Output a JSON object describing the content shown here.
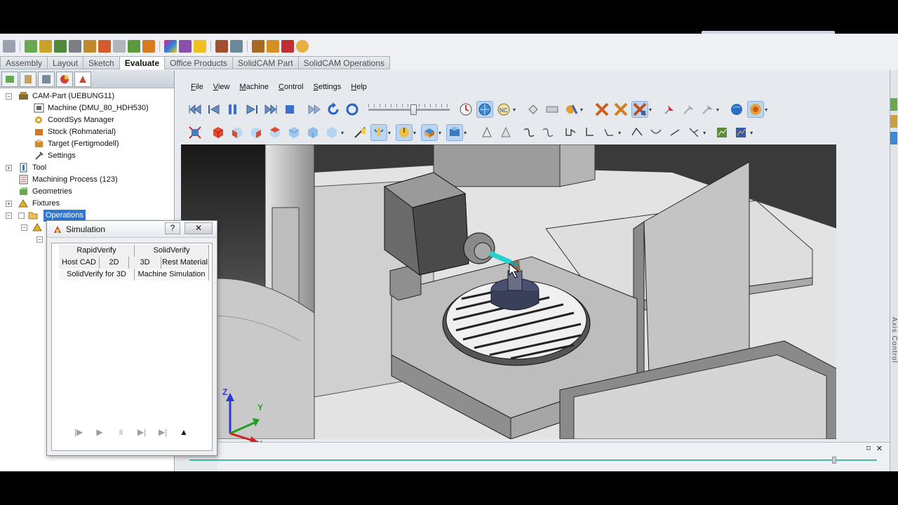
{
  "command_tabs": [
    "Assembly",
    "Layout",
    "Sketch",
    "Evaluate",
    "Office Products",
    "SolidCAM Part",
    "SolidCAM Operations"
  ],
  "active_command_tab": "Evaluate",
  "tree": {
    "root": "CAM-Part (UEBUNG11)",
    "machine": "Machine (DMU_80_HDH530)",
    "coordsys": "CoordSys Manager",
    "stock": "Stock (Rohmaterial)",
    "target": "Target (Fertigmodell)",
    "settings": "Settings",
    "tool": "Tool",
    "process": "Machining Process (123)",
    "geometries": "Geometries",
    "fixtures": "Fixtures",
    "operations": "Operations"
  },
  "simulation": {
    "title": "Simulation",
    "help": "?",
    "close": "✕",
    "tabs_row1": [
      "RapidVerify",
      "SolidVerify"
    ],
    "tabs_row2": [
      "Host CAD",
      "2D",
      "3D",
      "Rest Material"
    ],
    "tabs_row3": [
      "SolidVerify for 3D",
      "Machine Simulation"
    ]
  },
  "sc_menu": [
    "File",
    "View",
    "Machine",
    "Control",
    "Settings",
    "Help"
  ],
  "axis_labels": {
    "z": "Z",
    "y": "Y",
    "x": "X"
  },
  "side_label": "Axis Control",
  "bottom_controls": {
    "pin": "⌑",
    "close": "✕"
  }
}
